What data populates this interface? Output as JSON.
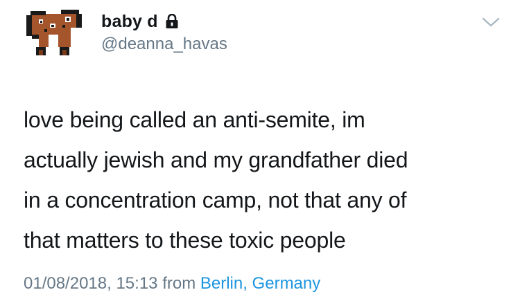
{
  "author": {
    "display_name": "baby d",
    "handle": "@deanna_havas",
    "avatar_icon": "pixel-dog-icon",
    "protected_icon": "lock-icon"
  },
  "menu": {
    "icon": "chevron-down-icon"
  },
  "tweet": {
    "lines": [
      "love being called an anti-semite, im",
      "actually jewish and my grandfather died",
      "in a concentration camp, not that any of",
      "that matters to these toxic people"
    ]
  },
  "meta": {
    "timestamp": "01/08/2018, 15:13",
    "from_label": "from",
    "location": "Berlin, Germany"
  },
  "colors": {
    "text": "#14171a",
    "secondary": "#657786",
    "link": "#1b95e0",
    "avatar_brown": "#a5552c"
  }
}
